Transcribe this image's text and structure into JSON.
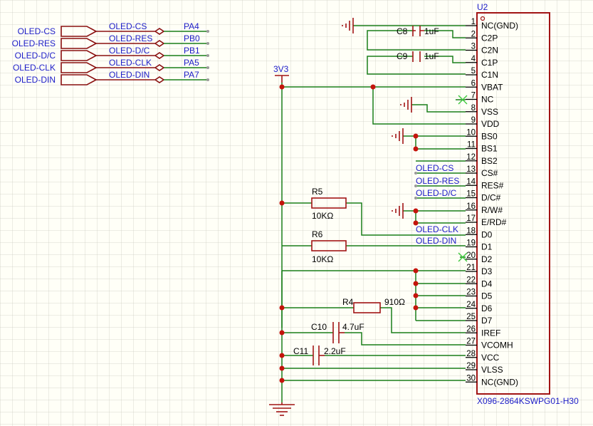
{
  "ports": [
    {
      "name": "OLED-CS",
      "label": "OLED-CS",
      "pin": "PA4"
    },
    {
      "name": "OLED-RES",
      "label": "OLED-RES",
      "pin": "PB0"
    },
    {
      "name": "OLED-D/C",
      "label": "OLED-D/C",
      "pin": "PB1"
    },
    {
      "name": "OLED-CLK",
      "label": "OLED-CLK",
      "pin": "PA5"
    },
    {
      "name": "OLED-DIN",
      "label": "OLED-DIN",
      "pin": "PA7"
    }
  ],
  "chip": {
    "designator": "U2",
    "part": "X096-2864KSWPG01-H30",
    "pins": [
      {
        "num": "1",
        "name": "NC(GND)"
      },
      {
        "num": "2",
        "name": "C2P"
      },
      {
        "num": "3",
        "name": "C2N"
      },
      {
        "num": "4",
        "name": "C1P"
      },
      {
        "num": "5",
        "name": "C1N"
      },
      {
        "num": "6",
        "name": "VBAT"
      },
      {
        "num": "7",
        "name": "NC"
      },
      {
        "num": "8",
        "name": "VSS"
      },
      {
        "num": "9",
        "name": "VDD"
      },
      {
        "num": "10",
        "name": "BS0"
      },
      {
        "num": "11",
        "name": "BS1"
      },
      {
        "num": "12",
        "name": "BS2"
      },
      {
        "num": "13",
        "name": "CS#"
      },
      {
        "num": "14",
        "name": "RES#"
      },
      {
        "num": "15",
        "name": "D/C#"
      },
      {
        "num": "16",
        "name": "R/W#"
      },
      {
        "num": "17",
        "name": "E/RD#"
      },
      {
        "num": "18",
        "name": "D0"
      },
      {
        "num": "19",
        "name": "D1"
      },
      {
        "num": "20",
        "name": "D2"
      },
      {
        "num": "21",
        "name": "D3"
      },
      {
        "num": "22",
        "name": "D4"
      },
      {
        "num": "23",
        "name": "D5"
      },
      {
        "num": "24",
        "name": "D6"
      },
      {
        "num": "25",
        "name": "D7"
      },
      {
        "num": "26",
        "name": "IREF"
      },
      {
        "num": "27",
        "name": "VCOMH"
      },
      {
        "num": "28",
        "name": "VCC"
      },
      {
        "num": "29",
        "name": "VLSS"
      },
      {
        "num": "30",
        "name": "NC(GND)"
      }
    ]
  },
  "components": {
    "c8": {
      "ref": "C8",
      "value": "1uF"
    },
    "c9": {
      "ref": "C9",
      "value": "1uF"
    },
    "c10": {
      "ref": "C10",
      "value": "4.7uF"
    },
    "c11": {
      "ref": "C11",
      "value": "2.2uF"
    },
    "r4": {
      "ref": "R4",
      "value": "910Ω"
    },
    "r5": {
      "ref": "R5",
      "value": "10KΩ"
    },
    "r6": {
      "ref": "R6",
      "value": "10KΩ"
    }
  },
  "power": {
    "rail": "3V3"
  },
  "net_labels": {
    "cs": "OLED-CS",
    "res": "OLED-RES",
    "dc": "OLED-D/C",
    "clk": "OLED-CLK",
    "din": "OLED-DIN"
  },
  "colors": {
    "wire": "#1a7f1a",
    "component": "#a11414",
    "label": "#1c1cc8",
    "junction": "#c4140c",
    "background": "#fffff7"
  }
}
